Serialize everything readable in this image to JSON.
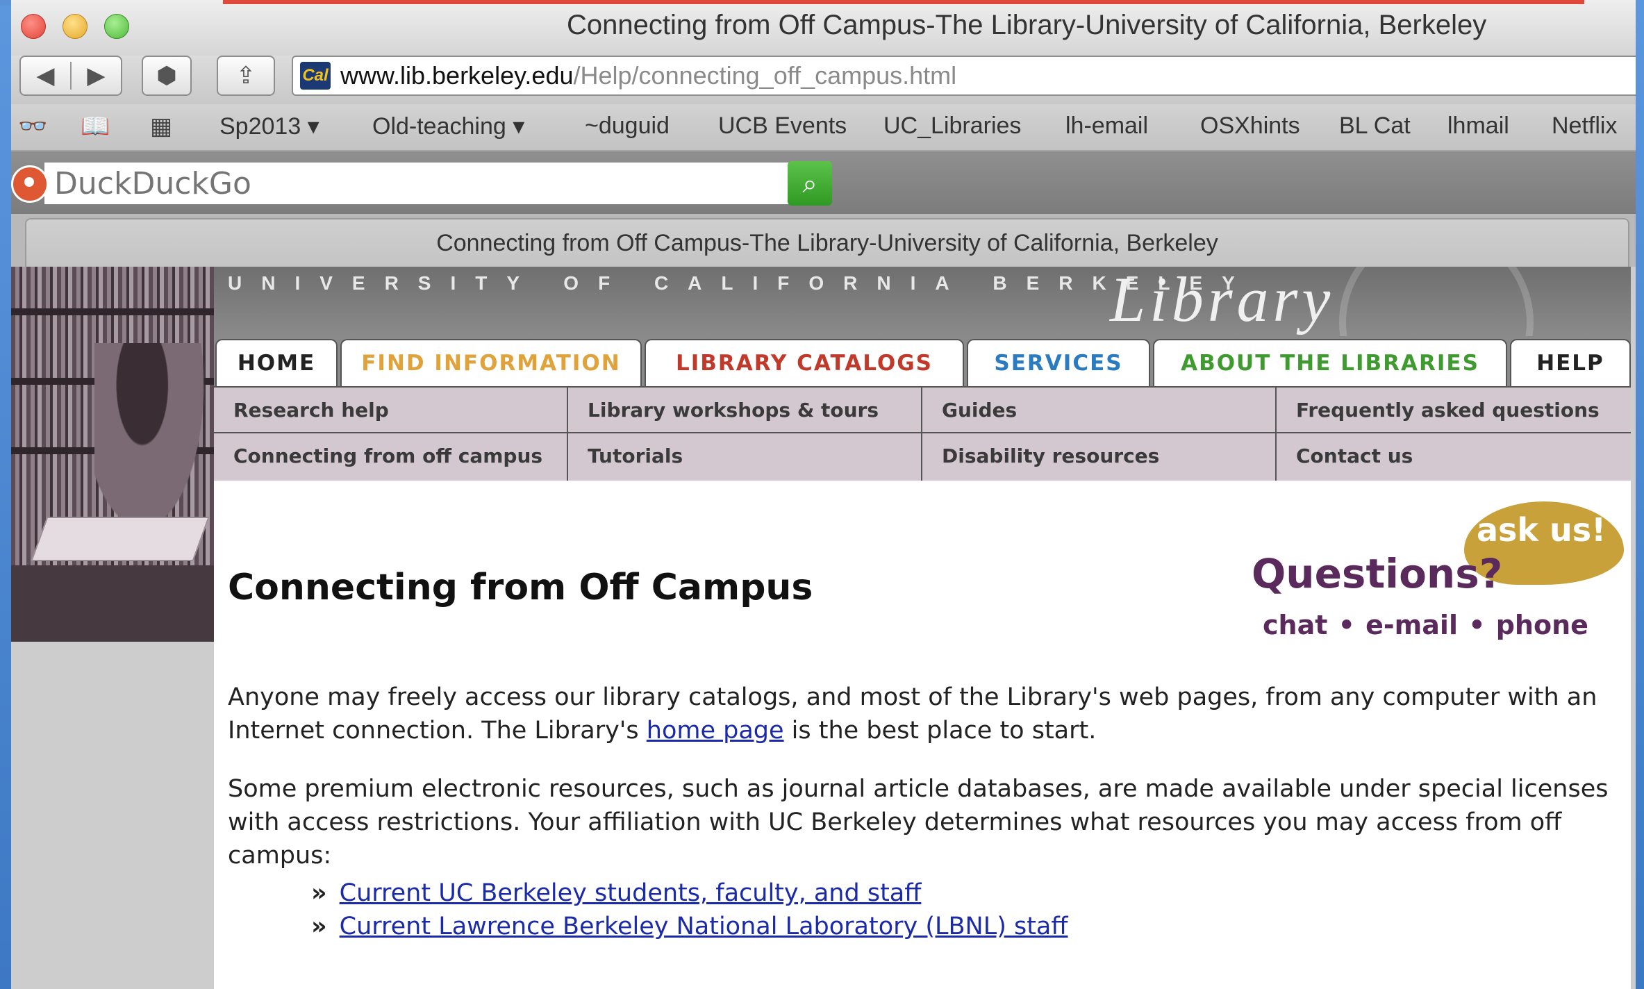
{
  "window": {
    "title": "Connecting from Off Campus-The Library-University of California, Berkeley"
  },
  "toolbar": {
    "url_domain": "www.lib.berkeley.edu",
    "url_path": "/Help/connecting_off_campus.html",
    "site_icon_text": "Cal"
  },
  "bookmarks": [
    "Sp2013 ▾",
    "Old-teaching ▾",
    "~duguid",
    "UCB Events",
    "UC_Libraries",
    "lh-email",
    "OSXhints",
    "BL Cat",
    "lhmail",
    "Netflix"
  ],
  "search_bar": {
    "placeholder": "DuckDuckGo"
  },
  "tab": {
    "title": "Connecting from Off Campus-The Library-University of California, Berkeley"
  },
  "banner": {
    "university": "UNIVERSITY OF CALIFORNIA BERKELEY",
    "library": "Library"
  },
  "nav": {
    "tabs": [
      {
        "label": "HOME",
        "color": "#222222"
      },
      {
        "label": "FIND INFORMATION",
        "color": "#e0a23a"
      },
      {
        "label": "LIBRARY CATALOGS",
        "color": "#c0392b"
      },
      {
        "label": "SERVICES",
        "color": "#2a7bbf"
      },
      {
        "label": "ABOUT THE LIBRARIES",
        "color": "#3f9a2f"
      },
      {
        "label": "HELP",
        "color": "#222222"
      }
    ]
  },
  "submenu": {
    "items": [
      "Research help",
      "Library workshops & tours",
      "Guides",
      "Frequently asked questions",
      "Connecting from off campus",
      "Tutorials",
      "Disability resources",
      "Contact us"
    ]
  },
  "content": {
    "title": "Connecting from Off Campus",
    "ask": "ask us!",
    "questions": "Questions?",
    "contact_modes": "chat • e-mail • phone",
    "para1_before": "Anyone may freely access our library catalogs, and most of the Library's web pages, from any computer with an Internet connection. The Library's ",
    "para1_link": "home page",
    "para1_after": " is the best place to start.",
    "para2": "Some premium electronic resources, such as journal article databases, are made available under special licenses with access restrictions. Your affiliation with UC Berkeley determines what resources you may access from off campus:",
    "bullet": "»",
    "links": [
      "Current UC Berkeley students, faculty, and staff",
      "Current Lawrence Berkeley National Laboratory (LBNL) staff"
    ]
  }
}
